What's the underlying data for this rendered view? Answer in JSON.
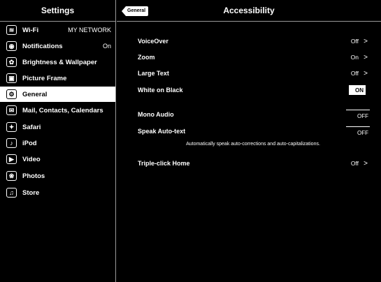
{
  "sidebar": {
    "title": "Settings",
    "items": [
      {
        "label": "Wi-Fi",
        "value": "MY NETWORK",
        "icon": "wifi-icon",
        "glyph": "≋"
      },
      {
        "label": "Notifications",
        "value": "On",
        "icon": "notifications-icon",
        "glyph": "◉"
      },
      {
        "label": "Brightness & Wallpaper",
        "value": "",
        "icon": "brightness-wallpaper-icon",
        "glyph": "✿"
      },
      {
        "label": "Picture Frame",
        "value": "",
        "icon": "picture-frame-icon",
        "glyph": "▣"
      },
      {
        "label": "General",
        "value": "",
        "icon": "gear-icon",
        "glyph": "⚙"
      },
      {
        "label": "Mail, Contacts, Calendars",
        "value": "",
        "icon": "mail-icon",
        "glyph": "✉"
      },
      {
        "label": "Safari",
        "value": "",
        "icon": "compass-icon",
        "glyph": "✦"
      },
      {
        "label": "iPod",
        "value": "",
        "icon": "ipod-icon",
        "glyph": "♪"
      },
      {
        "label": "Video",
        "value": "",
        "icon": "video-icon",
        "glyph": "▶"
      },
      {
        "label": "Photos",
        "value": "",
        "icon": "photos-icon",
        "glyph": "❀"
      },
      {
        "label": "Store",
        "value": "",
        "icon": "store-icon",
        "glyph": "♫"
      }
    ]
  },
  "detail": {
    "title": "Accessibility",
    "back_label": "General",
    "rows": {
      "voiceover": {
        "label": "VoiceOver",
        "value": "Off",
        "chevron": ">"
      },
      "zoom": {
        "label": "Zoom",
        "value": "On",
        "chevron": ">"
      },
      "large_text": {
        "label": "Large Text",
        "value": "Off",
        "chevron": ">"
      },
      "white_on_black": {
        "label": "White on Black",
        "value": "ON"
      },
      "mono_audio": {
        "label": "Mono Audio",
        "value": "OFF"
      },
      "speak_auto_text": {
        "label": "Speak Auto-text",
        "value": "OFF"
      },
      "triple_click": {
        "label": "Triple-click Home",
        "value": "Off",
        "chevron": ">"
      }
    },
    "speak_auto_text_note": "Automatically speak auto-corrections and auto-capitalizations."
  },
  "colors": {
    "background": "#000000",
    "foreground": "#ffffff",
    "divider": "#9a9a9a"
  }
}
